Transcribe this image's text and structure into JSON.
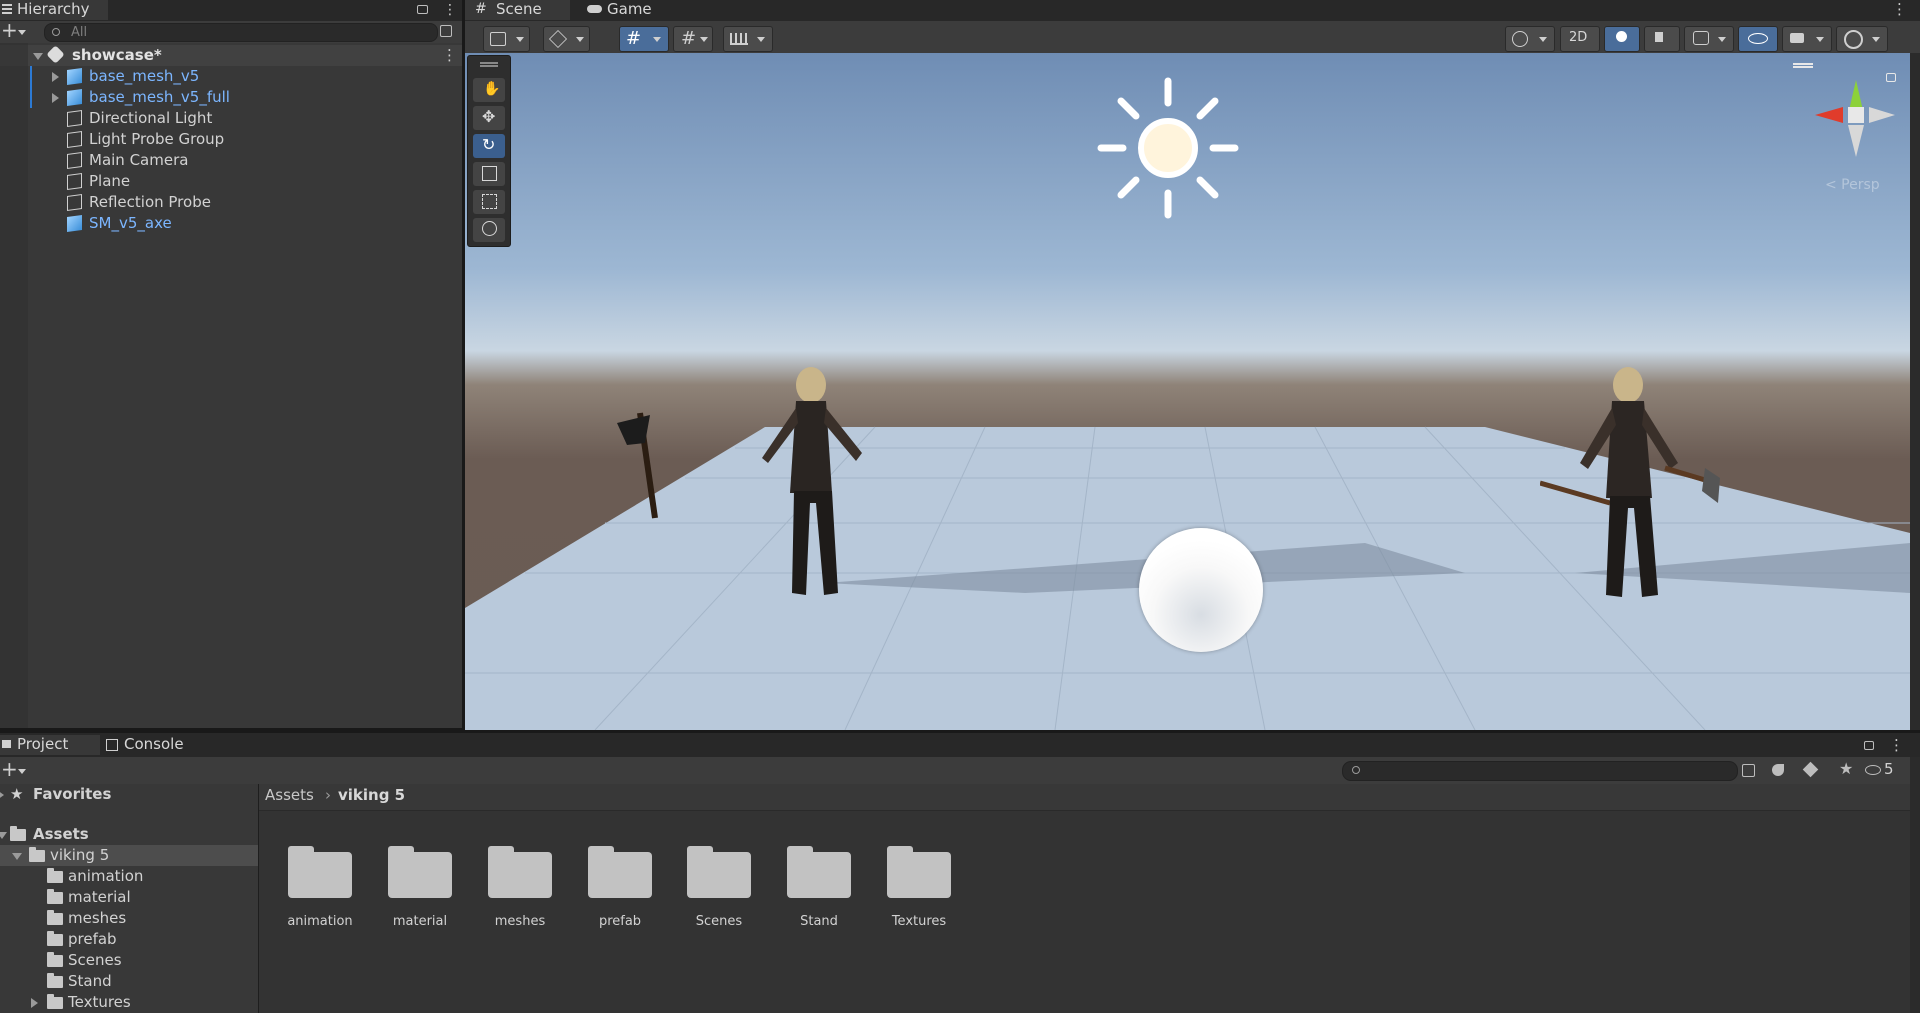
{
  "hierarchy": {
    "tab_label": "Hierarchy",
    "search_placeholder": "All",
    "scene_name": "showcase*",
    "items": [
      {
        "label": "base_mesh_v5",
        "prefab": true,
        "expandable": true
      },
      {
        "label": "base_mesh_v5_full",
        "prefab": true,
        "expandable": true
      },
      {
        "label": "Directional Light",
        "prefab": false,
        "expandable": false
      },
      {
        "label": "Light Probe Group",
        "prefab": false,
        "expandable": false
      },
      {
        "label": "Main Camera",
        "prefab": false,
        "expandable": false
      },
      {
        "label": "Plane",
        "prefab": false,
        "expandable": false
      },
      {
        "label": "Reflection Probe",
        "prefab": false,
        "expandable": false
      },
      {
        "label": "SM_v5_axe",
        "prefab": true,
        "expandable": false
      }
    ]
  },
  "scene": {
    "tabs": [
      {
        "label": "Scene",
        "icon": "grid-icon",
        "active": true
      },
      {
        "label": "Game",
        "icon": "gamepad-icon",
        "active": false
      }
    ],
    "toolbar": {
      "mode_2d_label": "2D"
    },
    "gizmo_persp_label": "< Persp",
    "tools": [
      "hand-tool",
      "move-tool",
      "rotate-tool",
      "scale-tool",
      "rect-tool",
      "transform-tool"
    ],
    "active_tool": "rotate-tool"
  },
  "project": {
    "tabs": [
      {
        "label": "Project",
        "icon": "folder-icon",
        "active": true
      },
      {
        "label": "Console",
        "icon": "console-icon",
        "active": false
      }
    ],
    "hidden_count": "5",
    "sidebar": {
      "favorites_label": "Favorites",
      "assets_label": "Assets",
      "selected_folder": "viking 5",
      "subfolders": [
        "animation",
        "material",
        "meshes",
        "prefab",
        "Scenes",
        "Stand",
        "Textures"
      ]
    },
    "breadcrumb": [
      "Assets",
      "viking 5"
    ],
    "folders": [
      "animation",
      "material",
      "meshes",
      "prefab",
      "Scenes",
      "Stand",
      "Textures"
    ]
  },
  "colors": {
    "accent_blue": "#7cb6ff",
    "selection_blue": "#2c5d87",
    "panel_bg": "#383838",
    "header_bg": "#282828"
  }
}
